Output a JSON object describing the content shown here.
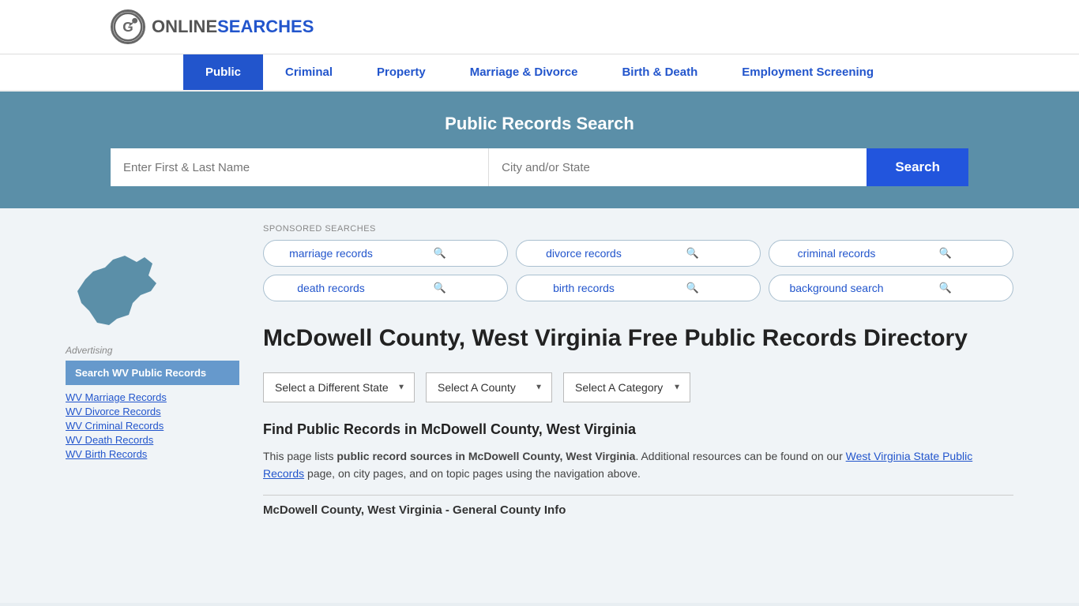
{
  "logo": {
    "icon_text": "G",
    "online": "ONLINE",
    "searches": "SEARCHES"
  },
  "nav": {
    "items": [
      {
        "label": "Public",
        "active": true
      },
      {
        "label": "Criminal",
        "active": false
      },
      {
        "label": "Property",
        "active": false
      },
      {
        "label": "Marriage & Divorce",
        "active": false
      },
      {
        "label": "Birth & Death",
        "active": false
      },
      {
        "label": "Employment Screening",
        "active": false
      }
    ]
  },
  "search_banner": {
    "title": "Public Records Search",
    "name_placeholder": "Enter First & Last Name",
    "location_placeholder": "City and/or State",
    "button_label": "Search"
  },
  "sponsored": {
    "label": "SPONSORED SEARCHES",
    "pills": [
      {
        "label": "marriage records"
      },
      {
        "label": "divorce records"
      },
      {
        "label": "criminal records"
      },
      {
        "label": "death records"
      },
      {
        "label": "birth records"
      },
      {
        "label": "background search"
      }
    ]
  },
  "page": {
    "title": "McDowell County, West Virginia Free Public Records Directory",
    "find_heading": "Find Public Records in McDowell County, West Virginia",
    "desc_part1": "This page lists ",
    "desc_bold": "public record sources in McDowell County, West Virginia",
    "desc_part2": ". Additional resources can be found on our ",
    "desc_link": "West Virginia State Public Records",
    "desc_part3": " page, on city pages, and on topic pages using the navigation above.",
    "general_info": "McDowell County, West Virginia - General County Info"
  },
  "dropdowns": {
    "state": {
      "label": "Select a Different State"
    },
    "county": {
      "label": "Select A County"
    },
    "category": {
      "label": "Select A Category"
    }
  },
  "sidebar": {
    "advertising_label": "Advertising",
    "ad_box": "Search WV Public Records",
    "links": [
      {
        "label": "WV Marriage Records"
      },
      {
        "label": "WV Divorce Records"
      },
      {
        "label": "WV Criminal Records"
      },
      {
        "label": "WV Death Records"
      },
      {
        "label": "WV Birth Records"
      }
    ]
  }
}
